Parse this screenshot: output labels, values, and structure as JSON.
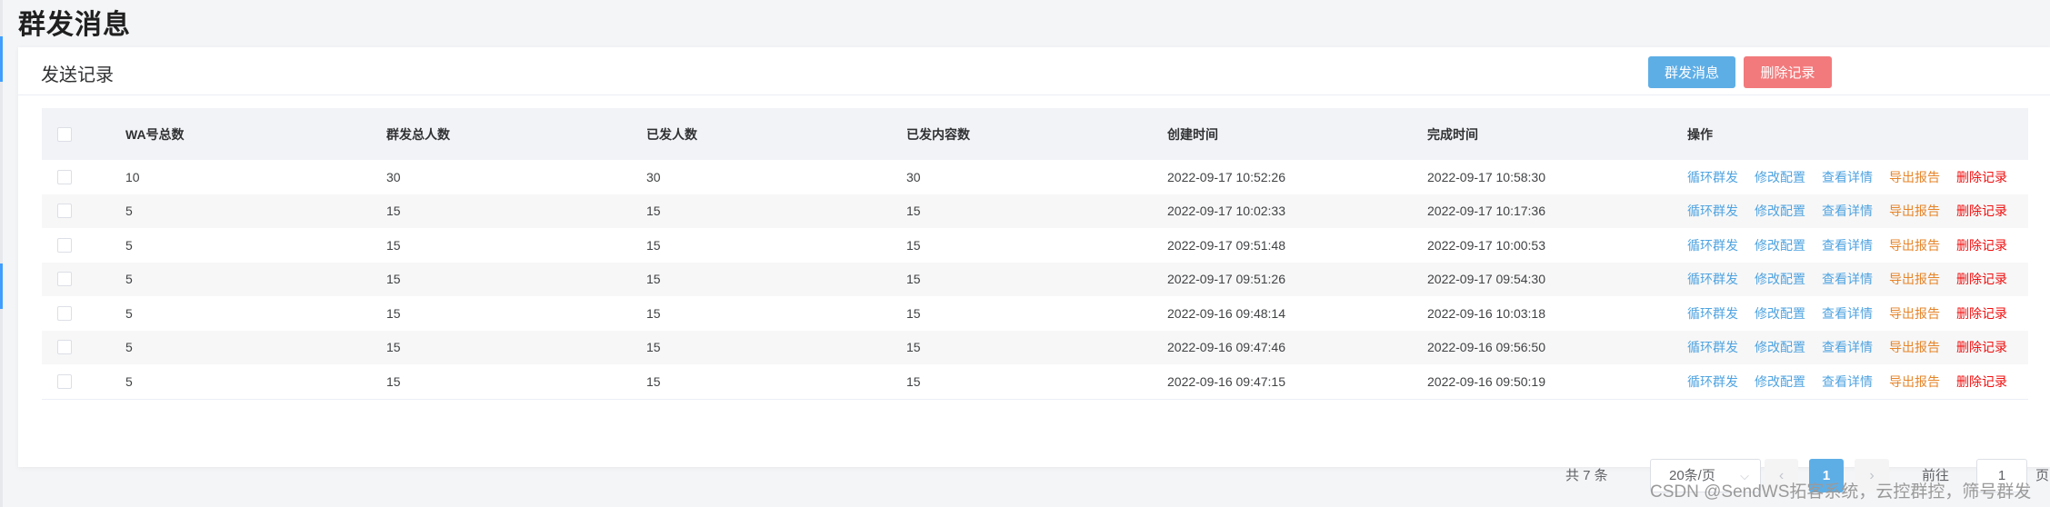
{
  "page": {
    "title": "群发消息"
  },
  "card": {
    "title": "发送记录",
    "buttons": {
      "mass_send": "群发消息",
      "delete_records": "删除记录"
    }
  },
  "table": {
    "columns": [
      "WA号总数",
      "群发总人数",
      "已发人数",
      "已发内容数",
      "创建时间",
      "完成时间",
      "操作"
    ],
    "actions": [
      "循环群发",
      "修改配置",
      "查看详情",
      "导出报告",
      "删除记录"
    ],
    "rows": [
      {
        "wa": "10",
        "total": "30",
        "sent": "30",
        "content": "30",
        "created": "2022-09-17 10:52:26",
        "finished": "2022-09-17 10:58:30"
      },
      {
        "wa": "5",
        "total": "15",
        "sent": "15",
        "content": "15",
        "created": "2022-09-17 10:02:33",
        "finished": "2022-09-17 10:17:36"
      },
      {
        "wa": "5",
        "total": "15",
        "sent": "15",
        "content": "15",
        "created": "2022-09-17 09:51:48",
        "finished": "2022-09-17 10:00:53"
      },
      {
        "wa": "5",
        "total": "15",
        "sent": "15",
        "content": "15",
        "created": "2022-09-17 09:51:26",
        "finished": "2022-09-17 09:54:30"
      },
      {
        "wa": "5",
        "total": "15",
        "sent": "15",
        "content": "15",
        "created": "2022-09-16 09:48:14",
        "finished": "2022-09-16 10:03:18"
      },
      {
        "wa": "5",
        "total": "15",
        "sent": "15",
        "content": "15",
        "created": "2022-09-16 09:47:46",
        "finished": "2022-09-16 09:56:50"
      },
      {
        "wa": "5",
        "total": "15",
        "sent": "15",
        "content": "15",
        "created": "2022-09-16 09:47:15",
        "finished": "2022-09-16 09:50:19"
      }
    ]
  },
  "pagination": {
    "total_text": "共 7 条",
    "page_size": "20条/页",
    "current_page": "1",
    "goto_label": "前往",
    "goto_value": "1",
    "page_unit": "页",
    "prev_icon": "chevron-left-icon",
    "next_icon": "chevron-right-icon",
    "dropdown_icon": "chevron-down-icon"
  },
  "watermark": "CSDN @SendWS拓客系统，云控群控，筛号群发",
  "colors": {
    "primary": "#5eaee6",
    "danger": "#f27a7c",
    "link_blue": "#4fa3e0",
    "link_orange": "#e6852a",
    "link_red": "#f00f0f"
  }
}
